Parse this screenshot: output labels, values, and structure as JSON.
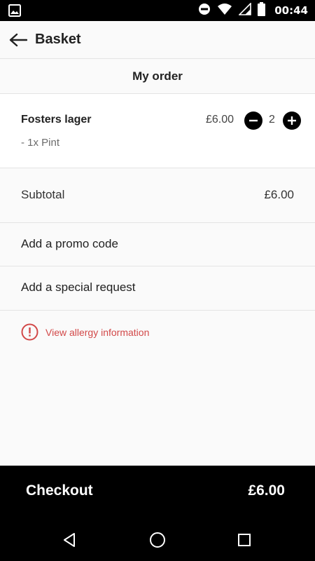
{
  "status_bar": {
    "time": "00:44",
    "icons": [
      "image-notification-icon",
      "do-not-disturb-icon",
      "wifi-icon",
      "signal-icon",
      "battery-icon"
    ]
  },
  "header": {
    "title": "Basket",
    "back_icon": "arrow-left-icon"
  },
  "order": {
    "section_title": "My order",
    "items": [
      {
        "name": "Fosters lager",
        "option": "- 1x Pint",
        "price": "£6.00",
        "quantity": "2"
      }
    ]
  },
  "summary": {
    "subtotal_label": "Subtotal",
    "subtotal_value": "£6.00",
    "promo_label": "Add a promo code",
    "special_request_label": "Add a special request"
  },
  "allergy": {
    "label": "View allergy information",
    "icon": "alert-circle-icon"
  },
  "checkout": {
    "label": "Checkout",
    "total": "£6.00"
  },
  "colors": {
    "accent_red": "#d24848",
    "bar_black": "#000000",
    "background": "#fafafa"
  }
}
